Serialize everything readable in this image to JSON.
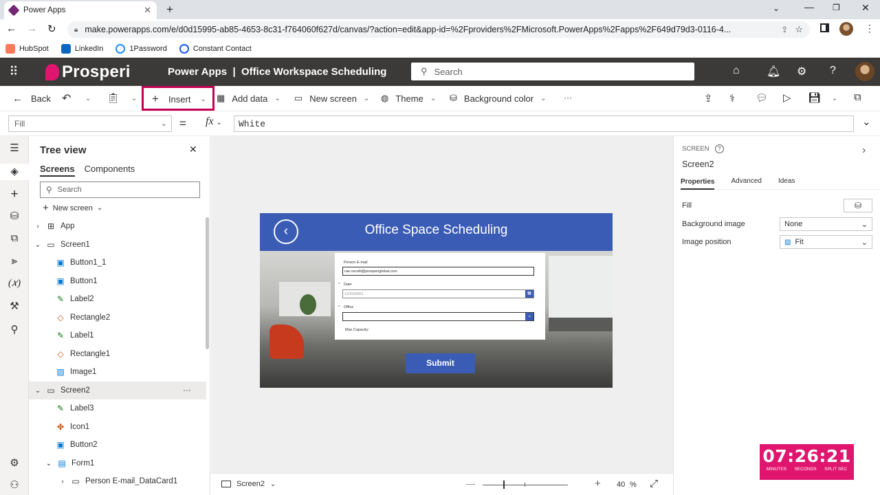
{
  "browser": {
    "tab_title": "Power Apps",
    "url": "make.powerapps.com/e/d0d15995-ab85-4653-8c31-f764060f627d/canvas/?action=edit&app-id=%2Fproviders%2FMicrosoft.PowerApps%2Fapps%2F649d79d3-0116-4...",
    "bookmarks": [
      "HubSpot",
      "LinkedIn",
      "1Password",
      "Constant Contact"
    ]
  },
  "header": {
    "brand": "Prosperi",
    "title": "Power Apps  |  Office Workspace Scheduling",
    "search_placeholder": "Search"
  },
  "commandbar": {
    "back": "Back",
    "insert": "Insert",
    "add_data": "Add data",
    "new_screen": "New screen",
    "theme": "Theme",
    "background_color": "Background color",
    "more": "···"
  },
  "formula": {
    "property": "Fill",
    "equals": "=",
    "fx": "fx",
    "value": "White"
  },
  "tree": {
    "title": "Tree view",
    "tabs": [
      "Screens",
      "Components"
    ],
    "search_placeholder": "Search",
    "new_screen": "New screen",
    "items": [
      {
        "label": "App",
        "icon": "app-icon"
      },
      {
        "label": "Screen1",
        "icon": "screen-icon"
      },
      {
        "label": "Button1_1",
        "icon": "button-icon"
      },
      {
        "label": "Button1",
        "icon": "button-icon"
      },
      {
        "label": "Label2",
        "icon": "label-icon"
      },
      {
        "label": "Rectangle2",
        "icon": "shape-icon"
      },
      {
        "label": "Label1",
        "icon": "label-icon"
      },
      {
        "label": "Rectangle1",
        "icon": "shape-icon"
      },
      {
        "label": "Image1",
        "icon": "image-icon"
      },
      {
        "label": "Screen2",
        "icon": "screen-icon"
      },
      {
        "label": "Label3",
        "icon": "label-icon"
      },
      {
        "label": "Icon1",
        "icon": "icon-icon"
      },
      {
        "label": "Button2",
        "icon": "button-icon"
      },
      {
        "label": "Form1",
        "icon": "form-icon"
      },
      {
        "label": "Person E-mail_DataCard1",
        "icon": "card-icon"
      }
    ],
    "more": "···"
  },
  "canvas_app": {
    "header_title": "Office Space Scheduling",
    "fields": [
      {
        "label": "Person E-mail",
        "value": "rae.cecelli@prosperiglobal.com"
      },
      {
        "label": "Date",
        "value": "12/31/2001"
      },
      {
        "label": "Office",
        "value": ""
      }
    ],
    "max_capacity_label": "Max Capacity:",
    "submit": "Submit"
  },
  "statusbar": {
    "screen": "Screen2",
    "zoom": "40",
    "zoom_unit": "%"
  },
  "properties": {
    "kind": "SCREEN",
    "name": "Screen2",
    "tabs": [
      "Properties",
      "Advanced",
      "Ideas"
    ],
    "rows": [
      {
        "label": "Fill",
        "value": ""
      },
      {
        "label": "Background image",
        "value": "None"
      },
      {
        "label": "Image position",
        "value": "Fit"
      }
    ]
  },
  "timer": {
    "time": "07:26:21",
    "labels": [
      "MINUTES",
      "SECONDS",
      "SPLIT SEC"
    ]
  },
  "colors": {
    "brand_header": "#3b3a39",
    "app_blue": "#3b5cb5",
    "highlight": "#c30052",
    "timer": "#e0156e"
  }
}
